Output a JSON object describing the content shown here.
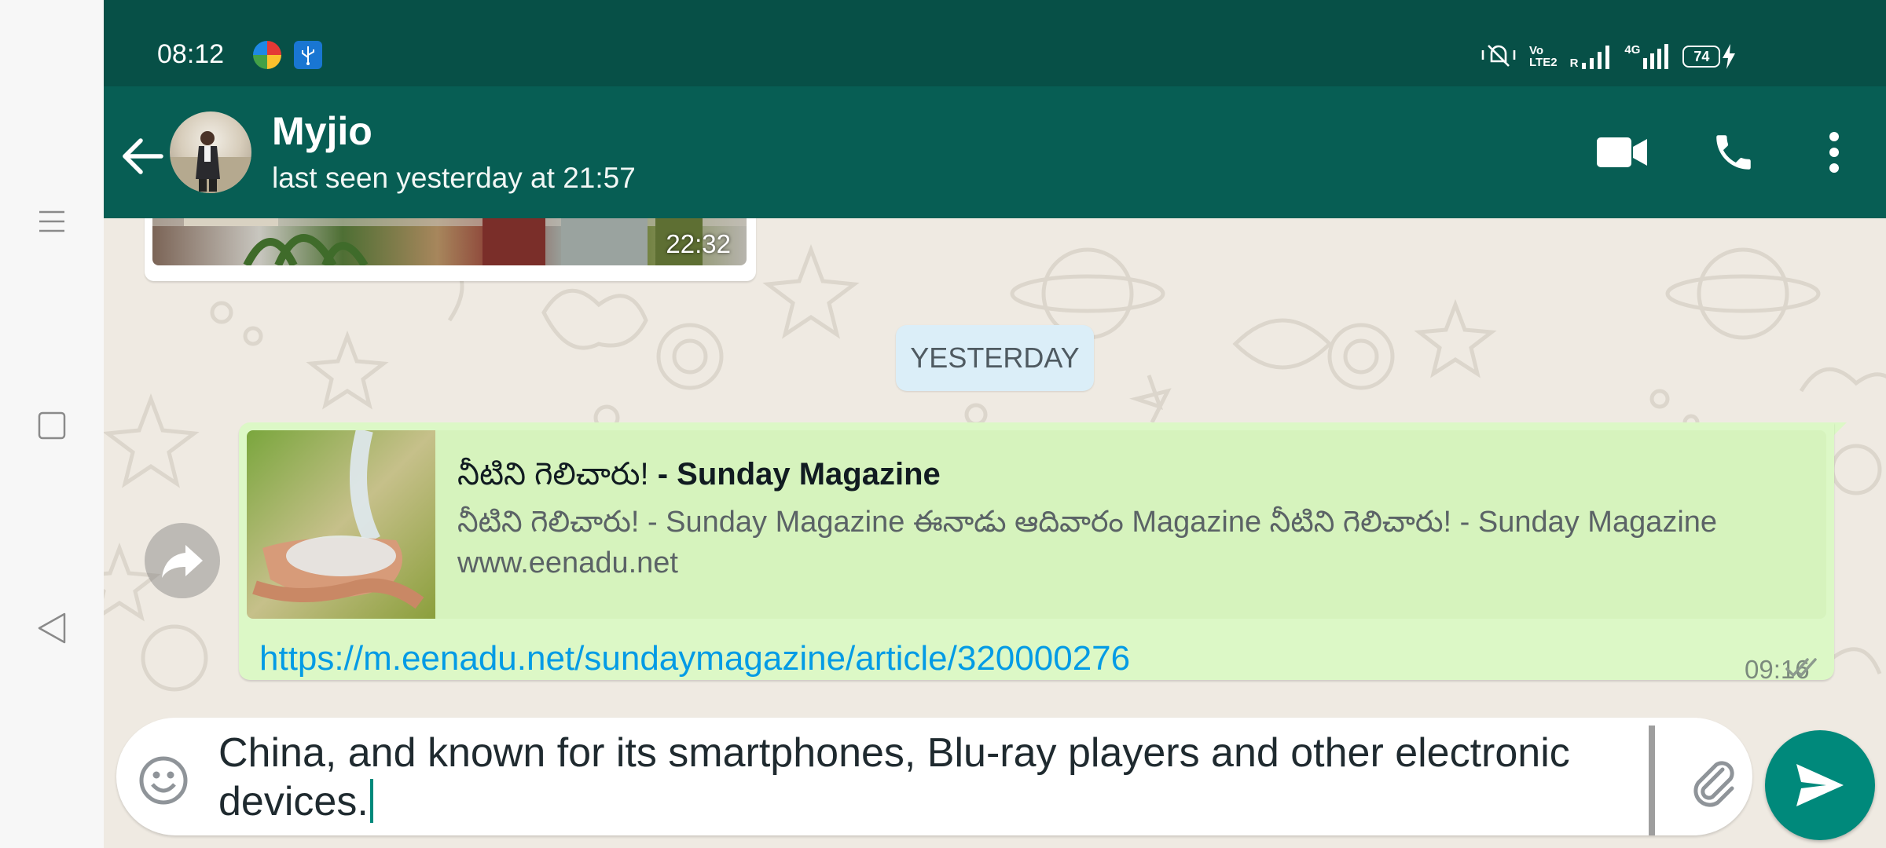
{
  "system_nav": {
    "menu_icon": "menu-icon",
    "home_icon": "square-icon",
    "back_icon": "triangle-back-icon"
  },
  "status_bar": {
    "time": "08:12",
    "network_4g": "4G",
    "battery": "74",
    "roaming": "R",
    "volte": "Vo",
    "lte": "LTE2"
  },
  "header": {
    "contact_name": "Myjio",
    "last_seen": "last seen yesterday at 21:57",
    "actions": [
      "video-call-icon",
      "voice-call-icon",
      "more-options-icon"
    ]
  },
  "messages": [
    {
      "type": "image",
      "time": "22:32"
    },
    {
      "type": "date_divider",
      "label": "YESTERDAY"
    },
    {
      "type": "link",
      "preview_title_telugu": "నీటిని గెలిచారు!",
      "preview_title_rest": " - Sunday Magazine",
      "preview_desc": "నీటిని గెలిచారు! - Sunday Magazine ఈనాడు ఆదివారం Magazine నీటిని గెలిచారు! - Sunday Magazine",
      "preview_domain": "www.eenadu.net",
      "url": "https://m.eenadu.net/sundaymagazine/article/320000276",
      "time": "09:16",
      "status": "delivered"
    }
  ],
  "composer": {
    "text_line1": "China, and known for its smartphones, Blu-ray players and other electronic",
    "text_line2": "devices."
  },
  "colors": {
    "header": "#075e54",
    "status_bar": "#075047",
    "outgoing_bubble": "#dcf8c6",
    "link": "#039be5",
    "send": "#00897b",
    "chat_bg": "#efeae2"
  }
}
